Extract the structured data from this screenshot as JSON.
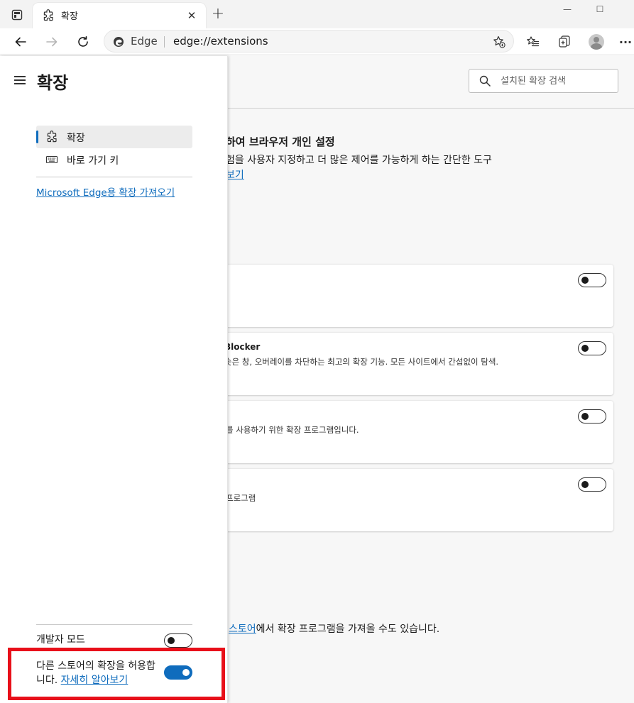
{
  "browser": {
    "tab": {
      "title": "확장",
      "close_glyph": "✕"
    },
    "new_tab_glyph": "+",
    "window": {
      "minimize_glyph": "—",
      "maximize_glyph": "☐"
    },
    "address": {
      "site_label": "Edge",
      "url": "edge://extensions"
    },
    "more_glyph": "···"
  },
  "panel": {
    "title": "확장",
    "nav": [
      {
        "label": "확장",
        "icon": "puzzle-icon",
        "active": true
      },
      {
        "label": "바로 가기 키",
        "icon": "keyboard-icon",
        "active": false
      }
    ],
    "get_extensions_link": "Microsoft Edge용 확장 가져오기",
    "developer_mode": {
      "label": "개발자 모드",
      "enabled": false
    },
    "allow_other_stores": {
      "text": "다른 스토어의 확장을 허용합니다.",
      "link": "자세히 알아보기",
      "enabled": true
    }
  },
  "main": {
    "search": {
      "placeholder": "설치된 확장 검색"
    },
    "hero": {
      "title": "하여 브라우저 개인 설정",
      "description": "험을 사용자 지정하고 더 많은 제어를 가능하게 하는 간단한 도구",
      "link": "보기"
    },
    "extensions": [
      {
        "name": "",
        "description": "",
        "enabled": false
      },
      {
        "name": "Blocker",
        "description": "솟은 창, 오버레이를 차단하는 최고의 확장 기능. 모든 사이트에서 간섭없이 탐색.",
        "enabled": false
      },
      {
        "name": "",
        "description": "를 사용하기 위한 확장 프로그램입니다.",
        "enabled": false
      },
      {
        "name": "",
        "description": "프로그램",
        "enabled": false
      }
    ],
    "store_line": {
      "link": "스토어",
      "text": "에서 확장 프로그램을 가져올 수도 있습니다."
    }
  },
  "colors": {
    "accent": "#0f6cbd",
    "highlight": "#e8101a"
  }
}
